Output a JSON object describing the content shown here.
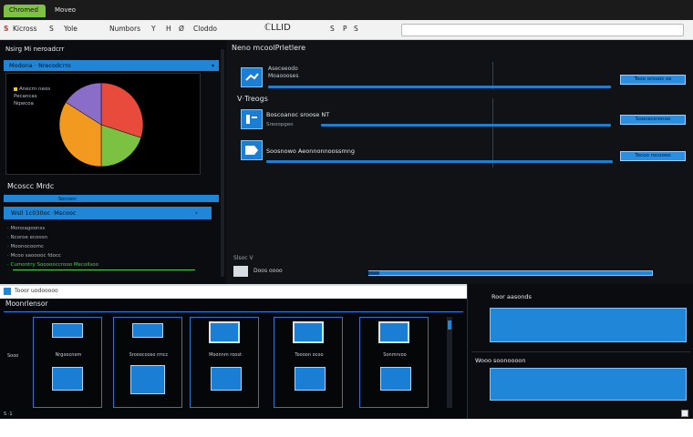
{
  "browser": {
    "tabs": [
      {
        "label": "Chromed",
        "active": true
      },
      {
        "label": "Moveo",
        "active": false
      }
    ],
    "toolbar_items": [
      "Kicross",
      "S",
      "Yole",
      "Numbors",
      "Y",
      "H",
      "Ø",
      "Cloddo",
      "ℂLLID",
      "S",
      "P",
      "S"
    ],
    "address": ""
  },
  "sidebar": {
    "header": "Nsirg Mi neroadcrr",
    "chart_panel_title": "Modona · Nrecodcrro",
    "chart_legend": [
      "Anecrn neos",
      "Pecancas",
      "Nqwcoa"
    ],
    "chart_data": {
      "type": "pie",
      "values": [
        30,
        20,
        34,
        16
      ],
      "colors": [
        "#e84a3c",
        "#7cc242",
        "#f29a1f",
        "#8a6cc9"
      ]
    },
    "list_title": "Mcoscc Mrdc",
    "list_subtitle": "Socnorc",
    "selected_item": "Wsll 1c030oc ·Mscooc",
    "items": [
      "Monoagoonss",
      "Ncoroe ecoosn",
      "Moonocoomc",
      "Mcoo saooooc fdocc",
      "Cumontry Soooooccrooo Mecollsoo"
    ]
  },
  "main": {
    "section1_title": "Neno mcoolPrletlere",
    "section1_item": "Aseceeodo\nMoaoooses",
    "section1_button": "Tooo oroooc ox",
    "section2_title": "V·Treogs",
    "rows": [
      {
        "title": "Boscoanoc sroose NT",
        "subtitle": "Sreoopgeo",
        "button": "Soocecsronoo"
      },
      {
        "title": "Soosnowo Aeonnonnoossmng",
        "subtitle": "",
        "button": "Tocoo rocoooo"
      }
    ],
    "footer_label": "Slsoc V",
    "footer_text": "Doos oooo"
  },
  "bottom": {
    "title": "Moonrlensor",
    "header_text": "Tooor uodooooo",
    "side_label": "Sooo",
    "cards": [
      "Nrgoocnem",
      "Srooocooso rmcc",
      "Moonnm roost",
      "Toooon ocoo",
      "Sonmrvoo"
    ],
    "footer_mark": "S ·1"
  },
  "right_panel": {
    "items": [
      {
        "label": "Roor aasonds"
      },
      {
        "label": "Wooo soonoooon"
      }
    ]
  },
  "colors": {
    "accent": "#1f86d8",
    "active_tab": "#7dc241",
    "panel_bg": "#0a0c0f"
  }
}
